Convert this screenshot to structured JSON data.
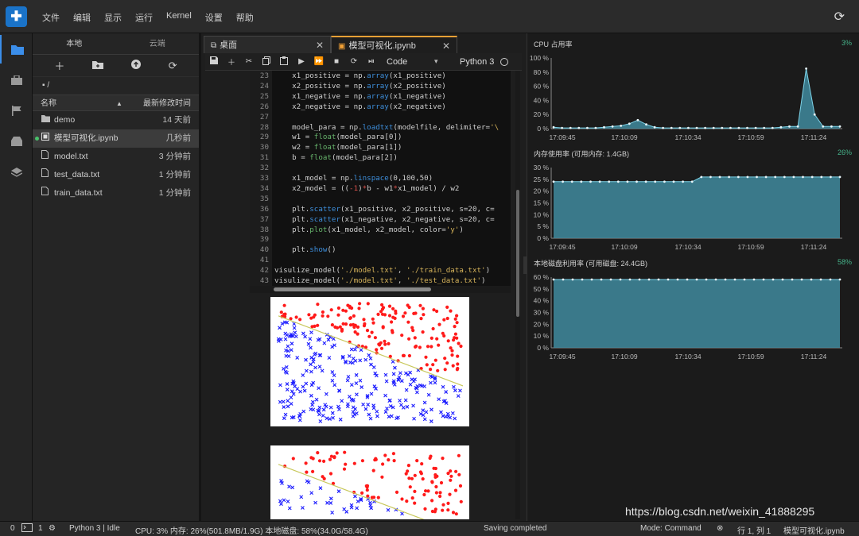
{
  "menu": [
    "文件",
    "编辑",
    "显示",
    "运行",
    "Kernel",
    "设置",
    "帮助"
  ],
  "sidebar": {
    "tabs": [
      "本地",
      "云端"
    ],
    "breadcrumb": "/",
    "header": {
      "name": "名称",
      "modified": "最新修改时间"
    },
    "files": [
      {
        "name": "demo",
        "time": "14 天前",
        "icon": "folder-icon"
      },
      {
        "name": "模型可视化.ipynb",
        "time": "几秒前",
        "icon": "notebook-icon"
      },
      {
        "name": "model.txt",
        "time": "3 分钟前",
        "icon": "file-icon"
      },
      {
        "name": "test_data.txt",
        "time": "1 分钟前",
        "icon": "file-icon"
      },
      {
        "name": "train_data.txt",
        "time": "1 分钟前",
        "icon": "file-icon"
      }
    ]
  },
  "notebook": {
    "tabs": [
      "桌面",
      "模型可视化.ipynb"
    ],
    "cell_type": "Code",
    "kernel": "Python 3",
    "line_numbers": [
      "23",
      "24",
      "25",
      "26",
      "27",
      "28",
      "29",
      "30",
      "31",
      "32",
      "33",
      "34",
      "35",
      "36",
      "37",
      "38",
      "39",
      "40",
      "41",
      "42",
      "43"
    ],
    "code_lines": [
      "    x1_positive = np.array(x1_positive)",
      "    x2_positive = np.array(x2_positive)",
      "    x1_negative = np.array(x1_negative)",
      "    x2_negative = np.array(x2_negative)",
      "",
      "    model_para = np.loadtxt(modelfile, delimiter='\\",
      "    w1 = float(model_para[0])",
      "    w2 = float(model_para[1])",
      "    b = float(model_para[2])",
      "",
      "    x1_model = np.linspace(0,100,50)",
      "    x2_model = ((-1)*b - w1*x1_model) / w2",
      "",
      "    plt.scatter(x1_positive, x2_positive, s=20, c=",
      "    plt.scatter(x1_negative, x2_negative, s=20, c=",
      "    plt.plot(x1_model, x2_model, color='y')",
      "",
      "    plt.show()",
      "",
      "visulize_model('./model.txt', './train_data.txt')",
      "visulize_model('./model.txt', './test_data.txt')"
    ]
  },
  "monitor": {
    "cpu": {
      "title": "CPU 占用率",
      "value": "3%"
    },
    "mem": {
      "title": "内存使用率 (可用内存: 1.4GB)",
      "value": "26%"
    },
    "disk": {
      "title": "本地磁盘利用率 (可用磁盘: 24.4GB)",
      "value": "58%"
    },
    "time_ticks": [
      "17:09:45",
      "17:10:09",
      "17:10:34",
      "17:10:59",
      "17:11:24"
    ],
    "cpu_ticks": [
      "100 %",
      "80 %",
      "60 %",
      "40 %",
      "20 %",
      "0 %"
    ],
    "mem_ticks": [
      "30 %",
      "25 %",
      "20 %",
      "15 %",
      "10 %",
      "5 %",
      "0 %"
    ],
    "disk_ticks": [
      "60 %",
      "50 %",
      "40 %",
      "30 %",
      "20 %",
      "10 %",
      "0 %"
    ],
    "colors": {
      "fill": "#3f8a9e",
      "line": "#7dd3e8",
      "accent": "#46b38a"
    }
  },
  "status": {
    "left_a": "0",
    "left_b": "1",
    "kernel": "Python 3 | Idle",
    "usage": "CPU: 3% 内存: 26%(501.8MB/1.9G) 本地磁盘: 58%(34.0G/58.4G)",
    "saving": "Saving completed",
    "mode": "Mode: Command",
    "position": "行 1, 列 1",
    "file": "模型可视化.ipynb"
  },
  "watermark": "https://blog.csdn.net/weixin_41888295",
  "chart_data": [
    {
      "type": "area",
      "x": [
        "17:09:45",
        "17:10:09",
        "17:10:34",
        "17:10:59",
        "17:11:24"
      ],
      "ylim": [
        0,
        100
      ],
      "values": [
        2,
        1,
        1,
        1,
        1,
        1,
        2,
        3,
        4,
        7,
        12,
        6,
        2,
        1,
        1,
        1,
        1,
        1,
        1,
        1,
        1,
        1,
        1,
        1,
        1,
        1,
        1,
        2,
        3,
        3,
        85,
        20,
        3,
        3,
        3
      ]
    },
    {
      "type": "area",
      "x": [
        "17:09:45",
        "17:10:09",
        "17:10:34",
        "17:10:59",
        "17:11:24"
      ],
      "ylim": [
        0,
        30
      ],
      "values": [
        24,
        24,
        24,
        24,
        24,
        24,
        24,
        24,
        24,
        24,
        24,
        24,
        24,
        24,
        24,
        24,
        26,
        26,
        26,
        26,
        26,
        26,
        26,
        26,
        26,
        26,
        26,
        26,
        26,
        26,
        26,
        26
      ]
    },
    {
      "type": "area",
      "x": [
        "17:09:45",
        "17:10:09",
        "17:10:34",
        "17:10:59",
        "17:11:24"
      ],
      "ylim": [
        0,
        60
      ],
      "values": [
        58,
        58,
        58,
        58,
        58,
        58,
        58,
        58,
        58,
        58,
        58,
        58,
        58,
        58,
        58,
        58,
        58,
        58,
        58,
        58,
        58,
        58,
        58,
        58,
        58,
        58,
        58,
        58,
        58,
        58,
        58
      ]
    }
  ]
}
